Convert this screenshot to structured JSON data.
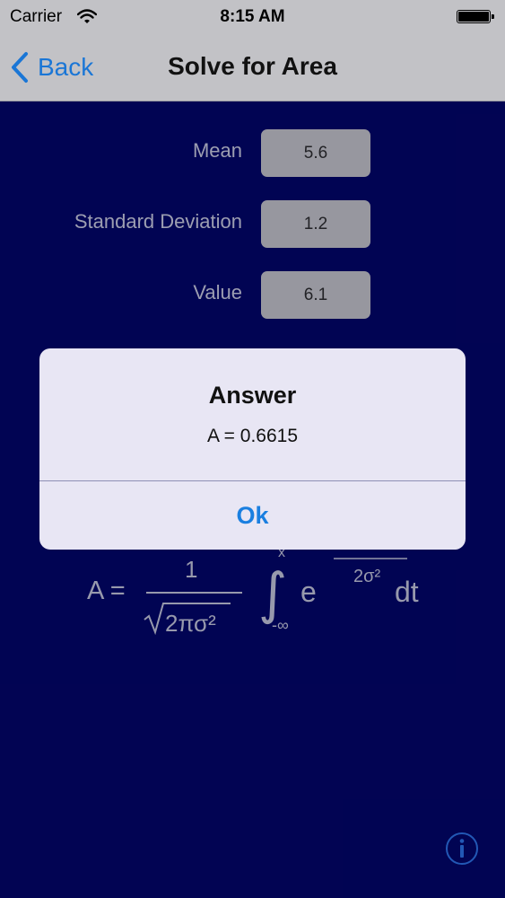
{
  "status": {
    "carrier": "Carrier",
    "time": "8:15 AM"
  },
  "nav": {
    "back_label": "Back",
    "title": "Solve for Area"
  },
  "form": {
    "mean_label": "Mean",
    "mean_value": "5.6",
    "sd_label": "Standard Deviation",
    "sd_value": "1.2",
    "value_label": "Value",
    "value_value": "6.1"
  },
  "formula": {
    "lhs": "A =",
    "numerator": "1",
    "denominator": "2πσ²",
    "upper_limit": "x",
    "lower_limit": "-∞",
    "base": "e",
    "exponent_denominator": "2σ²",
    "differential": "dt"
  },
  "alert": {
    "title": "Answer",
    "message": "A = 0.6615",
    "button_label": "Ok"
  },
  "colors": {
    "background": "#020561",
    "bar": "#c2c2c6",
    "accent": "#1a7fe0",
    "alert": "#e8e6f4"
  }
}
